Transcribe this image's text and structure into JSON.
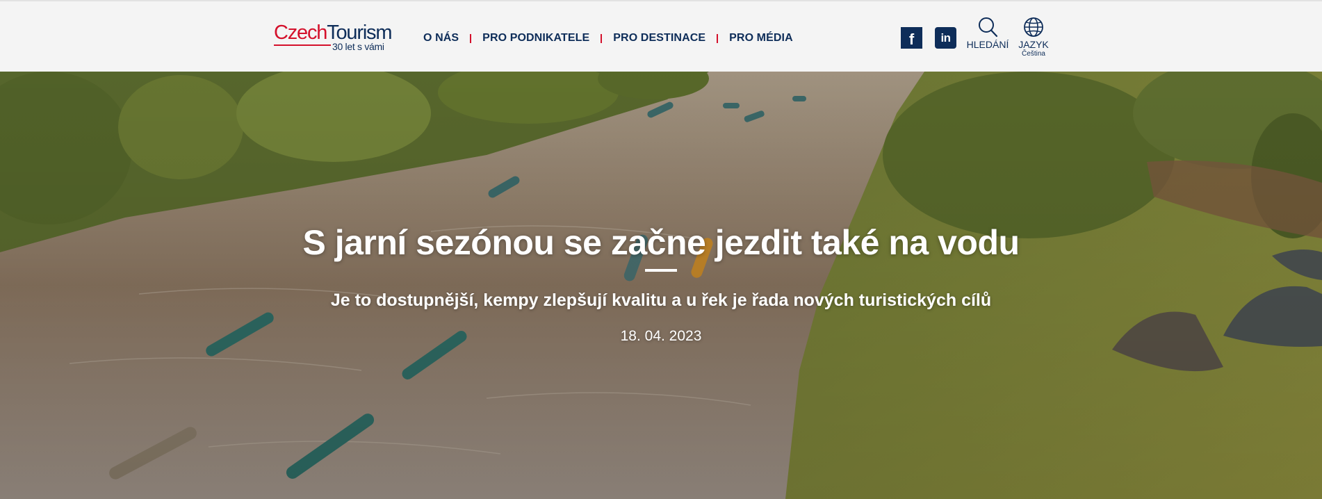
{
  "header": {
    "logo": {
      "brand_part1": "Czech",
      "brand_part2": "Tourism",
      "tagline": "30 let s vámi"
    },
    "nav": [
      {
        "label": "O NÁS"
      },
      {
        "label": "PRO PODNIKATELE"
      },
      {
        "label": "PRO DESTINACE"
      },
      {
        "label": "PRO MÉDIA"
      }
    ],
    "social": {
      "facebook_icon": "facebook-icon",
      "linkedin_icon": "linkedin-icon",
      "facebook_glyph": "f",
      "linkedin_glyph": "in"
    },
    "search": {
      "label": "HLEDÁNÍ",
      "icon": "search-icon"
    },
    "language": {
      "label": "JAZYK",
      "current": "Čeština",
      "icon": "globe-icon"
    }
  },
  "hero": {
    "title": "S jarní sezónou se začne jezdit také na vodu",
    "subtitle": "Je to dostupnější, kempy zlepšují kvalitu a u řek je řada nových turistických cílů",
    "date": "18. 04. 2023"
  },
  "colors": {
    "brand_red": "#d4102b",
    "brand_navy": "#0e2d59",
    "header_bg": "#f4f4f4",
    "river": "#8a7560",
    "grass": "#7d8a3a"
  }
}
